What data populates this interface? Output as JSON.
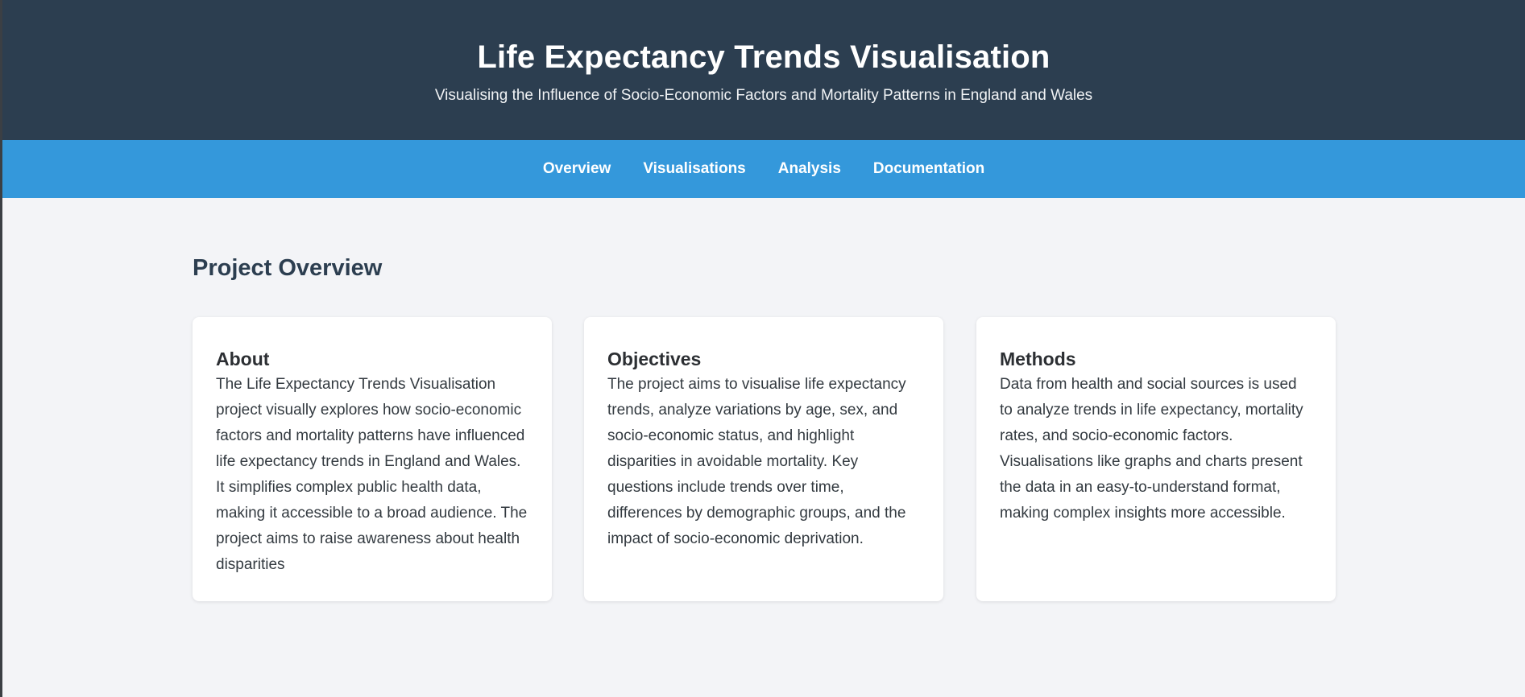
{
  "header": {
    "title": "Life Expectancy Trends Visualisation",
    "subtitle": "Visualising the Influence of Socio-Economic Factors and Mortality Patterns in England and Wales"
  },
  "nav": {
    "items": [
      {
        "label": "Overview"
      },
      {
        "label": "Visualisations"
      },
      {
        "label": "Analysis"
      },
      {
        "label": "Documentation"
      }
    ]
  },
  "main": {
    "section_title": "Project Overview",
    "cards": [
      {
        "title": "About",
        "text": "The Life Expectancy Trends Visualisation project visually explores how socio-economic factors and mortality patterns have influenced life expectancy trends in England and Wales. It simplifies complex public health data, making it accessible to a broad audience. The project aims to raise awareness about health disparities"
      },
      {
        "title": "Objectives",
        "text": "The project aims to visualise life expectancy trends, analyze variations by age, sex, and socio-economic status, and highlight disparities in avoidable mortality. Key questions include trends over time, differences by demographic groups, and the impact of socio-economic deprivation."
      },
      {
        "title": "Methods",
        "text": "Data from health and social sources is used to analyze trends in life expectancy, mortality rates, and socio-economic factors. Visualisations like graphs and charts present the data in an easy-to-understand format, making complex insights more accessible."
      }
    ]
  },
  "colors": {
    "header_bg": "#2c3e50",
    "nav_bg": "#3498db",
    "page_bg": "#f3f4f7",
    "heading": "#2c3e50"
  }
}
